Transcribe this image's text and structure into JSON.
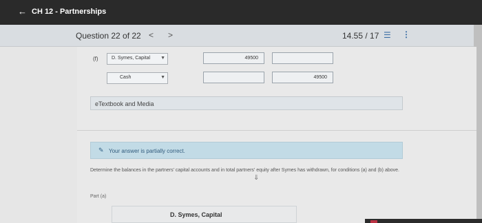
{
  "header": {
    "back_icon": "arrow-left-icon",
    "back_glyph": "←",
    "title": "CH 12 - Partnerships"
  },
  "question_bar": {
    "label": "Question 22 of 22",
    "prev_glyph": "<",
    "next_glyph": ">",
    "score": "14.55 / 17",
    "list_glyph": "☰",
    "more_glyph": "⋮"
  },
  "journal": {
    "row_label": "(f)",
    "rows": [
      {
        "account": "D. Symes, Capital",
        "debit": "49500",
        "credit": ""
      },
      {
        "account": "Cash",
        "debit": "",
        "credit": "49500"
      }
    ]
  },
  "etextbook": {
    "label": "eTextbook and Media"
  },
  "status": {
    "icon": "pencil-icon",
    "icon_glyph": "✎",
    "text": "Your answer is partially correct."
  },
  "instructions": "Determine the balances in the partners' capital accounts and in total partners' equity after Symes has withdrawn, for conditions (a) and (b) above.",
  "part_label": "Part (a)",
  "capital_label": "D. Symes, Capital",
  "colors": {
    "topbar": "#2a2a2a",
    "status_bg": "#c2dbe6",
    "accent": "#3b6ea5"
  }
}
